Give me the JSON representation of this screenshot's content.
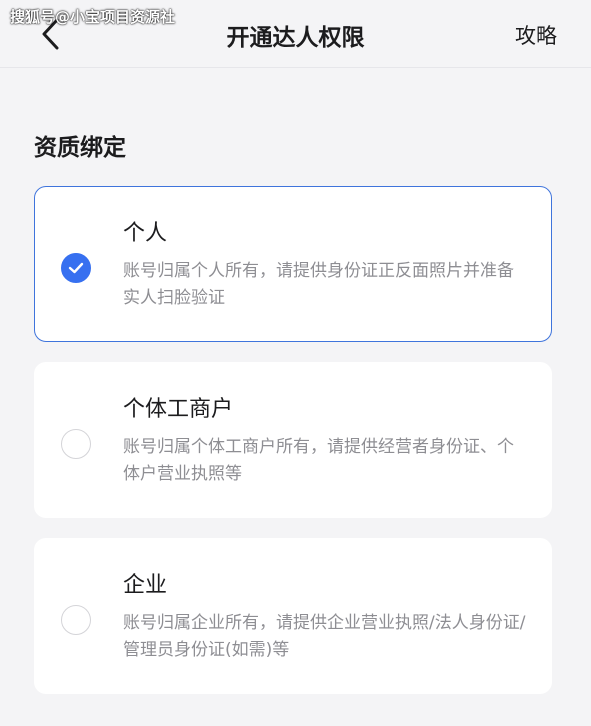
{
  "watermark": "搜狐号@小宝项目资源社",
  "header": {
    "title": "开通达人权限",
    "guide_label": "攻略"
  },
  "section": {
    "title": "资质绑定"
  },
  "options": [
    {
      "title": "个人",
      "description": "账号归属个人所有，请提供身份证正反面照片并准备实人扫脸验证",
      "selected": true
    },
    {
      "title": "个体工商户",
      "description": "账号归属个体工商户所有，请提供经营者身份证、个体户营业执照等",
      "selected": false
    },
    {
      "title": "企业",
      "description": "账号归属企业所有，请提供企业营业执照/法人身份证/管理员身份证(如需)等",
      "selected": false
    }
  ],
  "colors": {
    "accent": "#3770f0",
    "selected_border": "#3f74dc",
    "background": "#f4f4f6"
  }
}
